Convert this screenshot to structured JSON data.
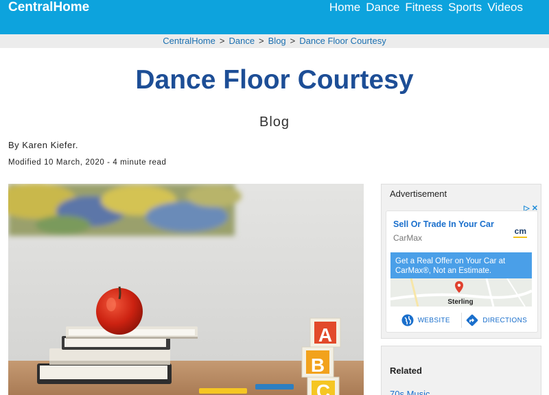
{
  "header": {
    "brand": "CentralHome",
    "nav": [
      "Home",
      "Dance",
      "Fitness",
      "Sports",
      "Videos"
    ]
  },
  "breadcrumb": [
    "CentralHome",
    "Dance",
    "Blog",
    "Dance Floor Courtesy"
  ],
  "article": {
    "title": "Dance Floor Courtesy",
    "section": "Blog",
    "author": "By Karen Kiefer.",
    "modified": "Modified 10 March, 2020 - 4 minute read",
    "hero_letters": [
      "A",
      "B",
      "C"
    ]
  },
  "ad": {
    "label": "Advertisement",
    "headline": "Sell Or Trade In Your Car",
    "advertiser": "CarMax",
    "logo_text": "cm",
    "offer": "Get a Real Offer on Your Car at CarMax®, Not an Estimate.",
    "map_place": "Sterling",
    "website_label": "WEBSITE",
    "directions_label": "DIRECTIONS"
  },
  "related": {
    "title": "Related",
    "first_link": "70s Music"
  },
  "colors": {
    "header_bg": "#0da3dd",
    "title": "#1d4e96",
    "link": "#1a6fcc"
  }
}
